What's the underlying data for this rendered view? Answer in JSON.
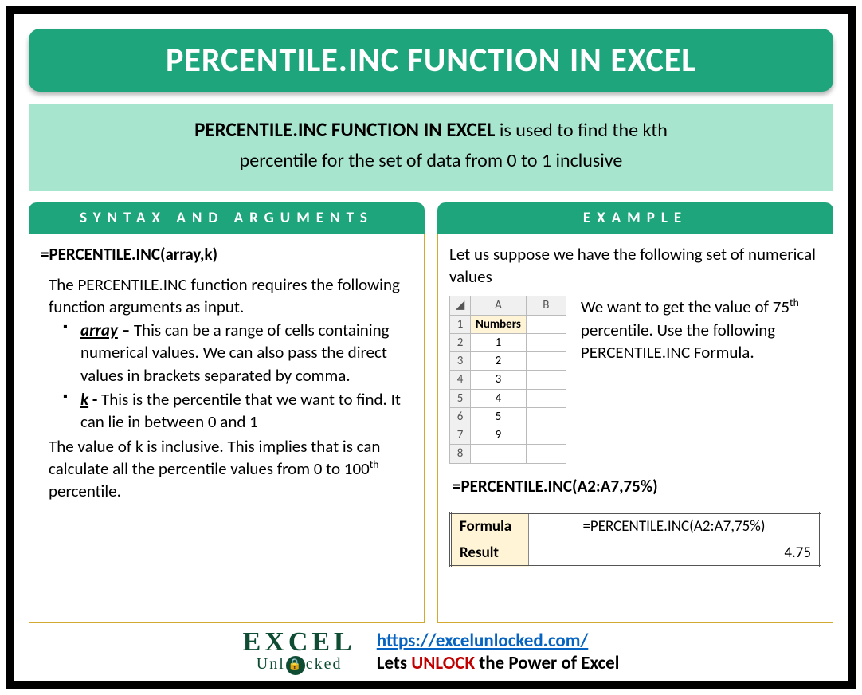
{
  "title": "PERCENTILE.INC FUNCTION IN EXCEL",
  "intro": {
    "strong": "PERCENTILE.INC FUNCTION IN EXCEL",
    "rest1": " is used to find the kth",
    "rest2": "percentile for the set of data from 0 to 1 inclusive"
  },
  "syntax": {
    "header": "SYNTAX AND ARGUMENTS",
    "formula": "=PERCENTILE.INC(array,k)",
    "lead": "The PERCENTILE.INC function requires the following function arguments as input.",
    "arg1_name": "array",
    "arg1_sep": " – ",
    "arg1_desc": "This can be a range of cells containing numerical values. We can also pass the direct values in brackets separated by comma.",
    "arg2_name": "k",
    "arg2_sep": " -  ",
    "arg2_desc": "This is the percentile that we want to find. It can lie in between 0 and 1",
    "trailer_a": "The value of k is inclusive. This implies that is can calculate all the percentile values from 0 to 100",
    "trailer_sup": "th",
    "trailer_b": " percentile."
  },
  "example": {
    "header": "EXAMPLE",
    "intro": "Let us suppose we have the following set of numerical values",
    "sheet": {
      "colA": "A",
      "colB": "B",
      "hdr": "Numbers",
      "rows": [
        "1",
        "2",
        "3",
        "4",
        "5",
        "6",
        "7",
        "8"
      ],
      "vals": [
        "1",
        "2",
        "3",
        "4",
        "5",
        "9"
      ]
    },
    "desc_a": "We want to get the value of 75",
    "desc_sup": "th",
    "desc_b": " percentile. Use the following PERCENTILE.INC Formula.",
    "formula": "=PERCENTILE.INC(A2:A7,75%)",
    "result": {
      "lbl1": "Formula",
      "val1": "=PERCENTILE.INC(A2:A7,75%)",
      "lbl2": "Result",
      "val2": "4.75"
    }
  },
  "footer": {
    "logo_top": "EXCEL",
    "logo_b1": "Unl",
    "logo_b2": "cked",
    "url": "https://excelunlocked.com/",
    "tag_a": "Lets ",
    "tag_unlock": "UNLOCK",
    "tag_b": " the Power of Excel"
  }
}
